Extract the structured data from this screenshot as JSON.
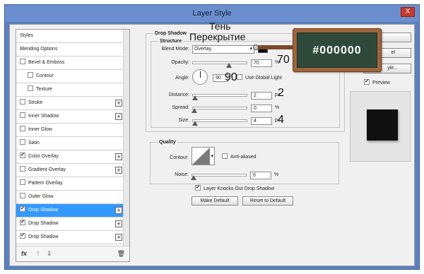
{
  "window": {
    "title": "Layer Style",
    "close": "X"
  },
  "left_panel": {
    "items": [
      {
        "label": "Styles",
        "checkbox": false,
        "sub": false,
        "plus": false
      },
      {
        "label": "Blending Options",
        "checkbox": false,
        "sub": false,
        "plus": false
      },
      {
        "label": "Bevel & Emboss",
        "checkbox": true,
        "checked": false,
        "sub": false,
        "plus": false
      },
      {
        "label": "Contour",
        "checkbox": true,
        "checked": false,
        "sub": true,
        "plus": false
      },
      {
        "label": "Texture",
        "checkbox": true,
        "checked": false,
        "sub": true,
        "plus": false
      },
      {
        "label": "Stroke",
        "checkbox": true,
        "checked": false,
        "sub": false,
        "plus": true
      },
      {
        "label": "Inner Shadow",
        "checkbox": true,
        "checked": false,
        "sub": false,
        "plus": true
      },
      {
        "label": "Inner Glow",
        "checkbox": true,
        "checked": false,
        "sub": false,
        "plus": false
      },
      {
        "label": "Satin",
        "checkbox": true,
        "checked": false,
        "sub": false,
        "plus": false
      },
      {
        "label": "Color Overlay",
        "checkbox": true,
        "checked": true,
        "sub": false,
        "plus": true
      },
      {
        "label": "Gradient Overlay",
        "checkbox": true,
        "checked": false,
        "sub": false,
        "plus": true
      },
      {
        "label": "Pattern Overlay",
        "checkbox": true,
        "checked": false,
        "sub": false,
        "plus": false
      },
      {
        "label": "Outer Glow",
        "checkbox": true,
        "checked": false,
        "sub": false,
        "plus": false
      },
      {
        "label": "Drop Shadow",
        "checkbox": true,
        "checked": true,
        "sub": false,
        "plus": true,
        "selected": true
      },
      {
        "label": "Drop Shadow",
        "checkbox": true,
        "checked": true,
        "sub": false,
        "plus": true
      },
      {
        "label": "Drop Shadow",
        "checkbox": true,
        "checked": true,
        "sub": false,
        "plus": true
      }
    ],
    "toolbar": {
      "fx": "fx",
      "up": "⇧",
      "down": "⇩",
      "trash": "🗑"
    }
  },
  "drop_shadow": {
    "title": "Drop Shadow",
    "structure_title": "Structure",
    "blend_mode_label": "Blend Mode:",
    "blend_mode_value": "Overlay",
    "color": "#000000",
    "opacity_label": "Opacity:",
    "opacity_value": "70",
    "opacity_unit": "%",
    "angle_label": "Angle:",
    "angle_value": "90",
    "angle_unit": "°",
    "global_light_label": "Use Global Light",
    "distance_label": "Distance:",
    "distance_value": "2",
    "distance_unit": "px",
    "spread_label": "Spread:",
    "spread_value": "0",
    "spread_unit": "%",
    "size_label": "Size:",
    "size_value": "4",
    "size_unit": "px",
    "quality_title": "Quality",
    "contour_label": "Contour:",
    "anti_aliased_label": "Anti-aliased",
    "noise_label": "Noise:",
    "noise_value": "0",
    "noise_unit": "%",
    "knockout_label": "Layer Knocks Out Drop Shadow",
    "make_default": "Make Default",
    "reset_default": "Reset to Default",
    "opacity_level": 0.7,
    "distance_level": 0.02,
    "spread_level": 0,
    "size_level": 0.02,
    "noise_level": 0
  },
  "right_panel": {
    "btn_ok_text": "",
    "btn_cancel_text": "el",
    "btn_newstyle_text": "yle...",
    "preview_label": "Preview"
  },
  "overlays": {
    "ru_shadow": "Тень",
    "ru_overlay": "Перекрытие",
    "num_70": "70",
    "num_90": "90",
    "num_2": "2",
    "num_4": "4",
    "chalk_color": "#000000"
  }
}
